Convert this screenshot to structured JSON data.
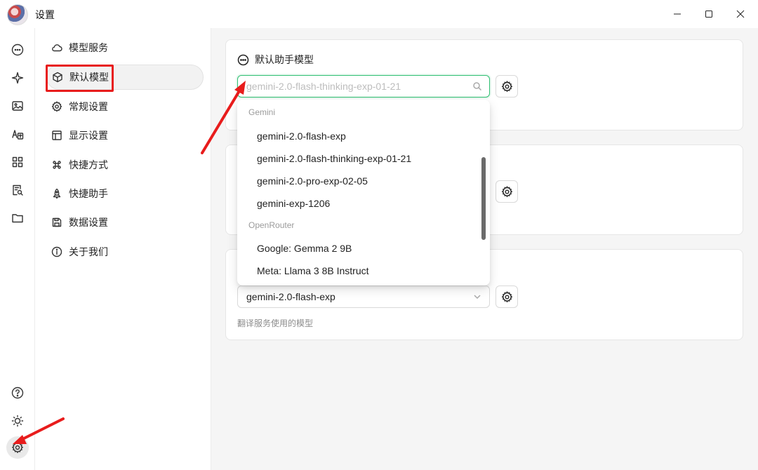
{
  "window": {
    "title": "设置",
    "controls": [
      "minimize-icon",
      "maximize-icon",
      "close-icon"
    ]
  },
  "rail": {
    "items": [
      "chat-icon",
      "sparkle-icon",
      "image-icon",
      "translate-icon",
      "apps-icon",
      "doc-search-icon",
      "folder-icon"
    ],
    "bottom": [
      "help-icon",
      "sun-icon",
      "gear-icon"
    ]
  },
  "nav": {
    "items": [
      {
        "label": "模型服务",
        "icon": "cloud-icon"
      },
      {
        "label": "默认模型",
        "icon": "cube-icon"
      },
      {
        "label": "常规设置",
        "icon": "gear-icon"
      },
      {
        "label": "显示设置",
        "icon": "layout-icon"
      },
      {
        "label": "快捷方式",
        "icon": "command-icon"
      },
      {
        "label": "快捷助手",
        "icon": "rocket-icon"
      },
      {
        "label": "数据设置",
        "icon": "save-icon"
      },
      {
        "label": "关于我们",
        "icon": "info-icon"
      }
    ],
    "active_index": 1
  },
  "cards": {
    "assistant": {
      "title": "默认助手模型",
      "placeholder": "gemini-2.0-flash-thinking-exp-01-21"
    },
    "translate": {
      "value": "gemini-2.0-flash-exp",
      "hint": "翻译服务使用的模型"
    }
  },
  "dropdown": {
    "groups": [
      {
        "label": "Gemini",
        "options": [
          "gemini-2.0-flash-exp",
          "gemini-2.0-flash-thinking-exp-01-21",
          "gemini-2.0-pro-exp-02-05",
          "gemini-exp-1206"
        ]
      },
      {
        "label": "OpenRouter",
        "options": [
          "Google: Gemma 2 9B",
          "Meta: Llama 3 8B Instruct"
        ]
      }
    ]
  },
  "colors": {
    "accent_focus": "#2fbf71",
    "annotation_red": "#e81c1c",
    "main_bg": "#f5f5f5"
  }
}
